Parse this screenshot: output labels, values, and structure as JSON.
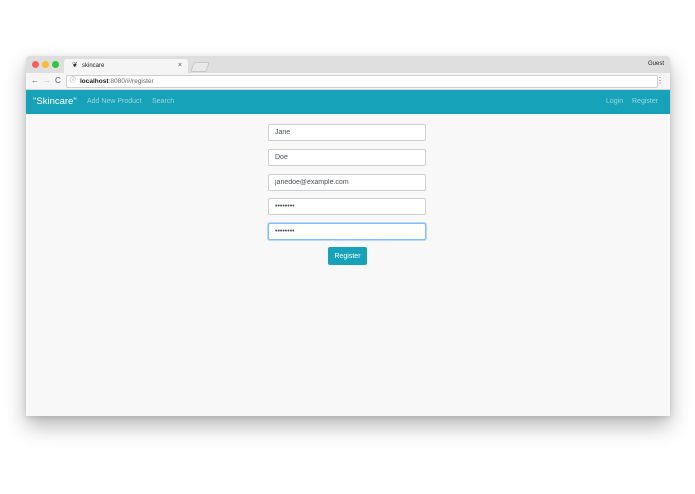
{
  "browser": {
    "tab_title": "skincare",
    "tab_close": "×",
    "profile_label": "Guest",
    "url_host": "localhost",
    "url_path": ":8080/#/register",
    "nav": {
      "back": "←",
      "forward": "→",
      "reload": "C"
    },
    "info_icon": "ⓘ",
    "menu": "⋮"
  },
  "navbar": {
    "brand": "\"Skincare\"",
    "links": [
      "Add New Product",
      "Search"
    ],
    "right_links": [
      "Login",
      "Register"
    ],
    "color": "#16a2b8"
  },
  "form": {
    "first_name": {
      "value": "Jane"
    },
    "last_name": {
      "value": "Doe"
    },
    "email": {
      "value": "janedoe@example.com"
    },
    "password": {
      "value": "••••••••"
    },
    "confirm_password": {
      "value": "••••••••",
      "focused": true
    },
    "submit_label": "Register"
  }
}
